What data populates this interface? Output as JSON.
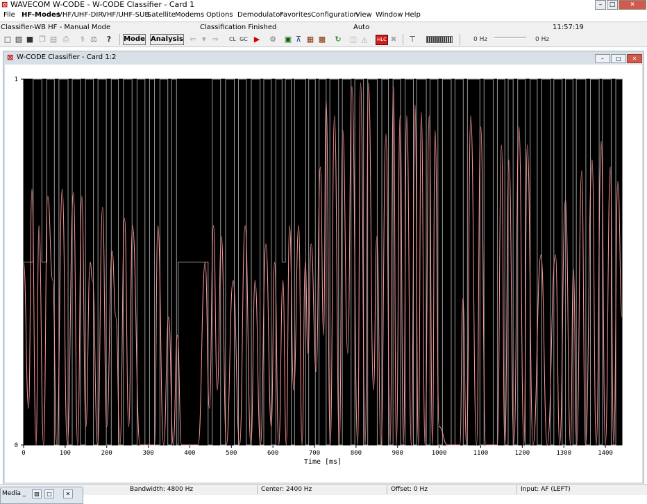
{
  "window": {
    "title": "WAVECOM W-CODE - W-CODE Classifier - Card 1",
    "logo_icon": "wavecom-logo-icon",
    "controls": [
      "minimize",
      "maximize",
      "close"
    ]
  },
  "menu": [
    "File",
    "HF-Modes",
    "VHF/UHF-DIR",
    "VHF/UHF-SUB",
    "Satellite",
    "Modems",
    "Options",
    "Demodulator",
    "Favorites",
    "Configuration",
    "View",
    "Window",
    "Help"
  ],
  "status_top": {
    "mode": "Classifier-WB HF - Manual Mode",
    "state": "Classification Finished",
    "auto": "Auto",
    "time": "11:57:19"
  },
  "toolbar": {
    "mode_label": "Mode",
    "analysis_label": "Analysis",
    "freq_left": "0 Hz",
    "freq_right": "0 Hz"
  },
  "child": {
    "title": "W-CODE Classifier  - Card 1:2"
  },
  "status_bottom": {
    "bandwidth": "Bandwidth: 4800 Hz",
    "center": "Center: 2400 Hz",
    "offset": "Offset: 0 Hz",
    "input": "Input: AF (LEFT)"
  },
  "media": {
    "label": "Media _"
  },
  "chart_data": {
    "type": "line",
    "xlabel": "Time [ms]",
    "xlim": [
      0,
      1440
    ],
    "ylim": [
      0,
      1
    ],
    "x_ticks": [
      0,
      100,
      200,
      300,
      400,
      500,
      600,
      700,
      800,
      900,
      1000,
      1100,
      1200,
      1300,
      1400
    ],
    "y_ticks": [
      0,
      1
    ],
    "background": "#000000",
    "series": [
      {
        "name": "",
        "color": "#9a9a9a",
        "style": "step",
        "transitions_ms": [
          0,
          23,
          44,
          56,
          74,
          85,
          107,
          117,
          137,
          149,
          168,
          179,
          199,
          211,
          228,
          240,
          261,
          273,
          292,
          303,
          315,
          328,
          347,
          356,
          368,
          372,
          444,
          454,
          474,
          486,
          507,
          517,
          536,
          548,
          569,
          578,
          596,
          607,
          622,
          630,
          644,
          652,
          679,
          686,
          702,
          711,
          728,
          737,
          758,
          767,
          788,
          797,
          818,
          828,
          851,
          862,
          878,
          889,
          907,
          918,
          938,
          946,
          969,
          978,
          997,
          1008,
          1029,
          1038,
          1058,
          1068,
          1098,
          1108,
          1130,
          1140,
          1158,
          1166,
          1178,
          1189,
          1207,
          1219,
          1236,
          1247,
          1268,
          1276,
          1296,
          1304,
          1322,
          1330,
          1353,
          1364,
          1385,
          1393,
          1414,
          1425
        ],
        "levels": [
          0.5,
          1,
          0.5,
          1,
          0,
          1,
          0,
          1,
          0,
          1,
          0,
          1,
          0,
          1,
          0,
          1,
          0,
          1,
          0,
          1,
          0,
          1,
          0,
          1,
          0,
          0.5,
          0,
          1,
          0,
          1,
          0,
          1,
          0,
          1,
          0,
          1,
          0,
          1,
          0.5,
          1,
          0,
          1,
          0,
          1,
          0,
          1,
          0,
          1,
          0,
          1,
          0,
          1,
          0,
          1,
          0,
          1,
          0,
          1,
          0,
          1,
          0,
          1,
          0,
          1,
          0,
          1,
          0,
          1,
          0,
          1,
          0,
          1,
          0,
          1,
          0,
          1,
          0,
          1,
          0,
          1,
          0,
          1,
          0,
          1,
          0,
          1,
          0,
          1,
          0,
          1,
          0,
          1,
          0,
          1
        ]
      },
      {
        "name": "",
        "color": "#ff9a9a",
        "style": "line",
        "peaks": [
          [
            0,
            0.5
          ],
          [
            12,
            0.1
          ],
          [
            20,
            0.7
          ],
          [
            30,
            0.0
          ],
          [
            37,
            0.6
          ],
          [
            48,
            0.0
          ],
          [
            58,
            0.68
          ],
          [
            70,
            0.45
          ],
          [
            80,
            0.0
          ],
          [
            93,
            0.7
          ],
          [
            105,
            0.0
          ],
          [
            120,
            0.69
          ],
          [
            130,
            0.0
          ],
          [
            140,
            0.68
          ],
          [
            150,
            0.05
          ],
          [
            160,
            0.5
          ],
          [
            166,
            0.45
          ],
          [
            178,
            0.0
          ],
          [
            190,
            0.65
          ],
          [
            200,
            0.05
          ],
          [
            213,
            0.53
          ],
          [
            222,
            0.35
          ],
          [
            232,
            0.0
          ],
          [
            243,
            0.62
          ],
          [
            253,
            0.05
          ],
          [
            262,
            0.6
          ],
          [
            280,
            0.0
          ],
          [
            300,
            0.0
          ],
          [
            315,
            0.0
          ],
          [
            323,
            0.6
          ],
          [
            337,
            0.0
          ],
          [
            349,
            0.35
          ],
          [
            360,
            0.0
          ],
          [
            370,
            0.3
          ],
          [
            380,
            0.0
          ],
          [
            400,
            0.0
          ],
          [
            420,
            0.0
          ],
          [
            437,
            0.5
          ],
          [
            447,
            0.1
          ],
          [
            457,
            0.6
          ],
          [
            466,
            0.15
          ],
          [
            476,
            0.57
          ],
          [
            488,
            0.0
          ],
          [
            504,
            0.45
          ],
          [
            520,
            0.0
          ],
          [
            533,
            0.6
          ],
          [
            547,
            0.0
          ],
          [
            557,
            0.45
          ],
          [
            570,
            0.0
          ],
          [
            583,
            0.55
          ],
          [
            596,
            0.05
          ],
          [
            604,
            0.5
          ],
          [
            614,
            0.0
          ],
          [
            624,
            0.45
          ],
          [
            632,
            0.0
          ],
          [
            640,
            0.6
          ],
          [
            650,
            0.15
          ],
          [
            662,
            0.6
          ],
          [
            670,
            0.0
          ],
          [
            678,
            0.5
          ],
          [
            684,
            0.25
          ],
          [
            692,
            0.55
          ],
          [
            704,
            0.2
          ],
          [
            714,
            0.76
          ],
          [
            722,
            0.3
          ],
          [
            728,
            0.94
          ],
          [
            738,
            0.0
          ],
          [
            748,
            0.9
          ],
          [
            760,
            0.0
          ],
          [
            768,
            0.86
          ],
          [
            780,
            0.25
          ],
          [
            790,
            0.98
          ],
          [
            804,
            0.0
          ],
          [
            811,
            0.99
          ],
          [
            822,
            0.0
          ],
          [
            830,
            0.99
          ],
          [
            842,
            0.15
          ],
          [
            850,
            0.57
          ],
          [
            860,
            0.0
          ],
          [
            872,
            0.85
          ],
          [
            882,
            0.0
          ],
          [
            890,
            0.98
          ],
          [
            897,
            0.0
          ],
          [
            906,
            0.9
          ],
          [
            914,
            0.0
          ],
          [
            922,
            0.9
          ],
          [
            933,
            0.0
          ],
          [
            942,
            0.93
          ],
          [
            950,
            0.0
          ],
          [
            957,
            0.91
          ],
          [
            966,
            0.0
          ],
          [
            976,
            0.9
          ],
          [
            984,
            0.0
          ],
          [
            990,
            0.86
          ],
          [
            1000,
            0.05
          ],
          [
            1020,
            0.0
          ],
          [
            1040,
            0.0
          ],
          [
            1050,
            0.0
          ],
          [
            1057,
            0.4
          ],
          [
            1066,
            0.0
          ],
          [
            1076,
            0.9
          ],
          [
            1090,
            0.0
          ],
          [
            1100,
            0.87
          ],
          [
            1112,
            0.0
          ],
          [
            1128,
            0.0
          ],
          [
            1140,
            0.0
          ],
          [
            1150,
            0.82
          ],
          [
            1158,
            0.0
          ],
          [
            1168,
            0.78
          ],
          [
            1180,
            0.0
          ],
          [
            1192,
            0.87
          ],
          [
            1204,
            0.0
          ],
          [
            1212,
            0.82
          ],
          [
            1226,
            0.0
          ],
          [
            1245,
            0.52
          ],
          [
            1260,
            0.0
          ],
          [
            1280,
            0.52
          ],
          [
            1290,
            0.0
          ],
          [
            1304,
            0.67
          ],
          [
            1316,
            0.0
          ],
          [
            1323,
            0.48
          ],
          [
            1331,
            0.0
          ],
          [
            1343,
            0.75
          ],
          [
            1352,
            0.0
          ],
          [
            1368,
            0.78
          ],
          [
            1378,
            0.0
          ],
          [
            1390,
            0.83
          ],
          [
            1400,
            0.0
          ],
          [
            1412,
            0.76
          ],
          [
            1420,
            0.0
          ],
          [
            1430,
            0.72
          ],
          [
            1440,
            0.35
          ]
        ]
      }
    ]
  }
}
